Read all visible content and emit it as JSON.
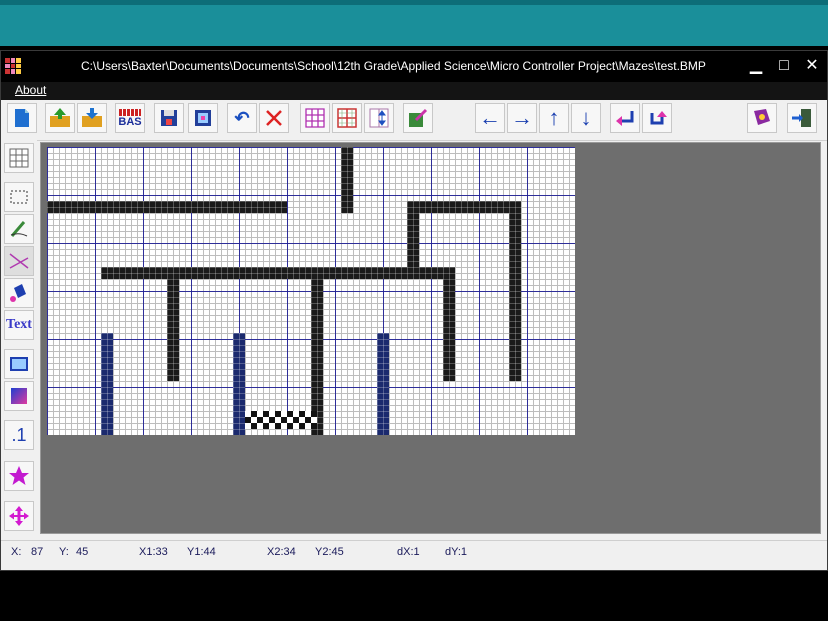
{
  "window": {
    "title": "C:\\Users\\Baxter\\Documents\\Documents\\School\\12th Grade\\Applied Science\\Micro Controller Project\\Mazes\\test.BMP",
    "minimize_label": "▁",
    "maximize_label": "□",
    "close_label": "✕"
  },
  "menu": {
    "about": "About"
  },
  "toolbar": {
    "bas_label": "BAS",
    "buttons": [
      "new-file",
      "open-up",
      "open-folder",
      "bas-export",
      "save-a",
      "save-b",
      "undo",
      "clear",
      "grid-a",
      "grid-b",
      "grid-c",
      "edit",
      "shift-left",
      "shift-right",
      "shift-up",
      "shift-down",
      "rotate-left",
      "rotate-right",
      "help-book",
      "exit"
    ]
  },
  "left_tools": {
    "text_label": "Text",
    "dot_label": ".1"
  },
  "status": {
    "x_label": "X:",
    "x_value": "87",
    "y_label": "Y:",
    "y_value": "45",
    "x1": "X1:33",
    "y1": "Y1:44",
    "x2": "X2:34",
    "y2": "Y2:45",
    "dx": "dX:1",
    "dy": "dY:1"
  },
  "colors": {
    "titlebar": "#000000",
    "grid_major": "#1e1e96",
    "wall": "#1a1a1a",
    "canvas_bg": "#6e6e6e"
  }
}
